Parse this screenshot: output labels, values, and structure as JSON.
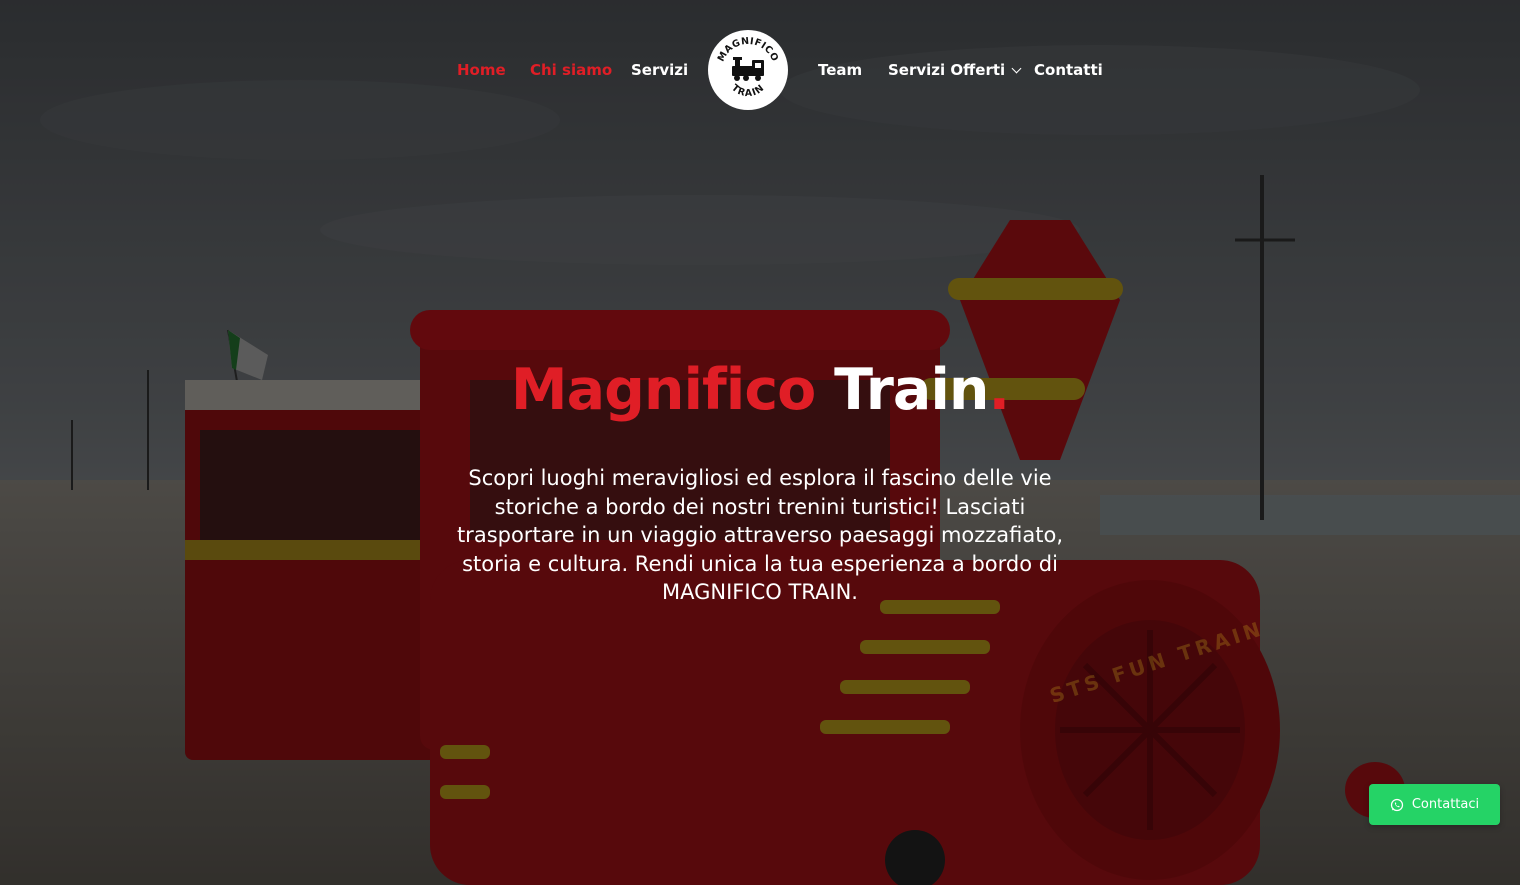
{
  "nav": {
    "items": [
      {
        "label": "Home",
        "active": true
      },
      {
        "label": "Chi siamo",
        "active": true
      },
      {
        "label": "Servizi",
        "active": false
      },
      {
        "label": "Team",
        "active": false
      },
      {
        "label": "Servizi Offerti",
        "active": false,
        "has_dropdown": true
      },
      {
        "label": "Contatti",
        "active": false
      }
    ],
    "logo_top_text": "MAGNIFICO",
    "logo_bottom_text": "TRAIN"
  },
  "hero": {
    "title_part1": "Magnifico",
    "title_part2": "Train",
    "title_dot": ".",
    "description": "Scopri luoghi meravigliosi ed esplora il fascino delle vie storiche a bordo dei nostri trenini turistici! Lasciati trasportare in un viaggio attraverso paesaggi mozzafiato, storia e cultura. Rendi unica la tua esperienza a bordo di MAGNIFICO TRAIN.",
    "image_train_text": "STS FUN TRAIN"
  },
  "contact_button": {
    "label": "Contattaci",
    "icon": "whatsapp-icon"
  },
  "colors": {
    "accent_red": "#e01e26",
    "whatsapp_green": "#25d366",
    "text_white": "#ffffff"
  }
}
